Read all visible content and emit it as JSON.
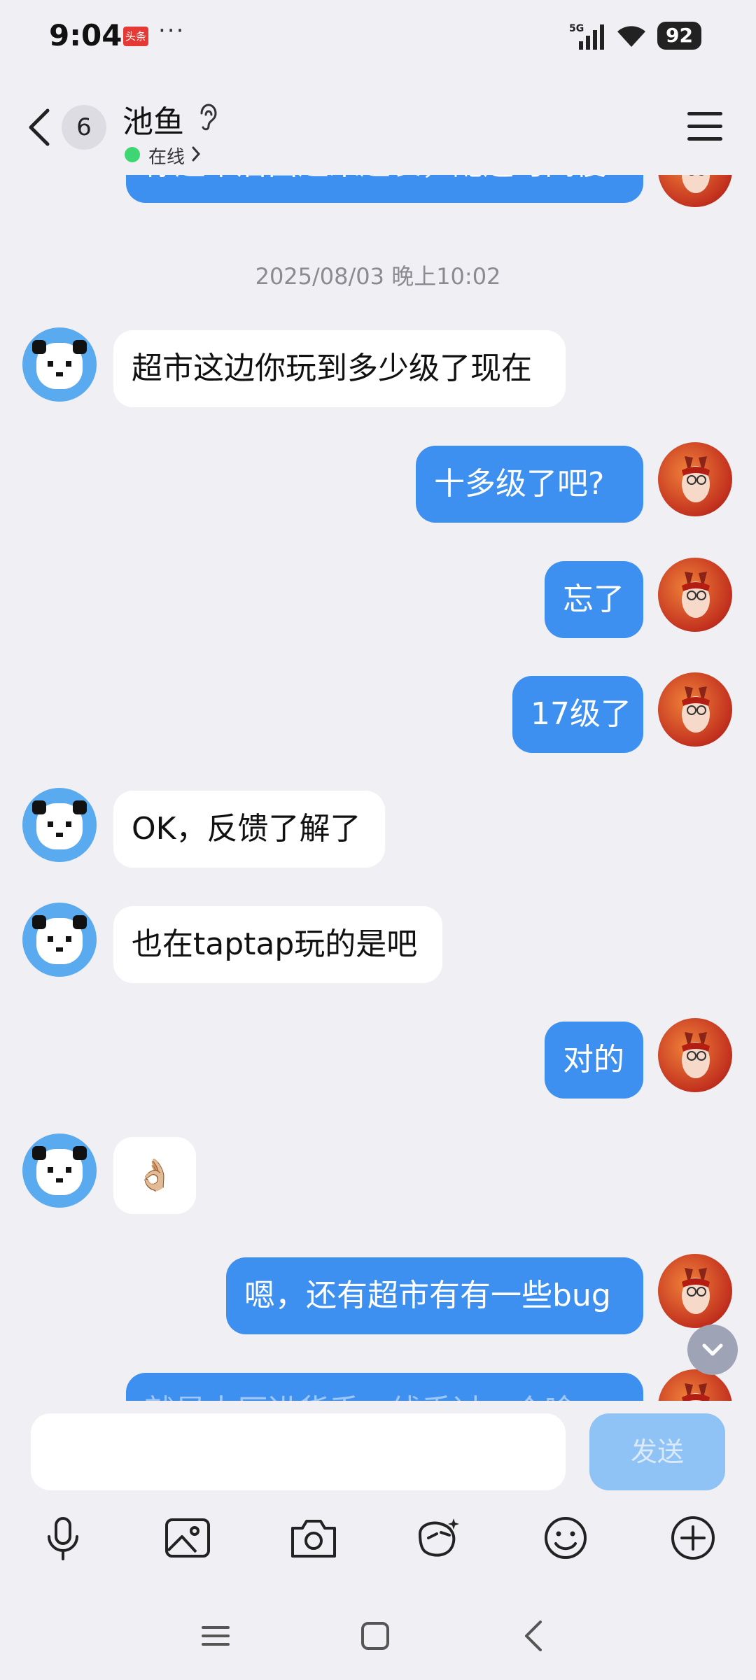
{
  "status_bar": {
    "time": "9:04",
    "news_badge": "头条",
    "more": "···",
    "network": "5G",
    "battery": "92"
  },
  "header": {
    "unread_count": "6",
    "contact_name": "池鱼",
    "status": "在线"
  },
  "chat": {
    "timestamp": "2025/08/03 晚上10:02",
    "messages": [
      {
        "side": "out",
        "text": "你超市后面越来越长，配送时间慢"
      },
      {
        "side": "in",
        "text": "超市这边你玩到多少级了现在"
      },
      {
        "side": "out",
        "text": "十多级了吧?"
      },
      {
        "side": "out",
        "text": "忘了"
      },
      {
        "side": "out",
        "text": "17级了"
      },
      {
        "side": "in",
        "text": "OK，反馈了解了"
      },
      {
        "side": "in",
        "text": "也在taptap玩的是吧"
      },
      {
        "side": "out",
        "text": "对的"
      },
      {
        "side": "in",
        "text": "👌🏼"
      },
      {
        "side": "out",
        "text": "嗯，还有超市有有一些bug"
      },
      {
        "side": "out",
        "text": "就是大厅进货手一线手过一个啥"
      }
    ]
  },
  "input": {
    "placeholder": "",
    "send_label": "发送"
  },
  "colors": {
    "outgoing_bubble": "#3d8ff0",
    "incoming_bubble": "#ffffff",
    "background": "#f0f0f4",
    "send_disabled": "#8fc2f5"
  },
  "toolbar_icons": [
    "microphone-icon",
    "image-icon",
    "camera-icon",
    "ai-assistant-icon",
    "emoji-icon",
    "plus-icon"
  ],
  "nav_icons": [
    "recent-apps-icon",
    "home-icon",
    "back-icon"
  ]
}
